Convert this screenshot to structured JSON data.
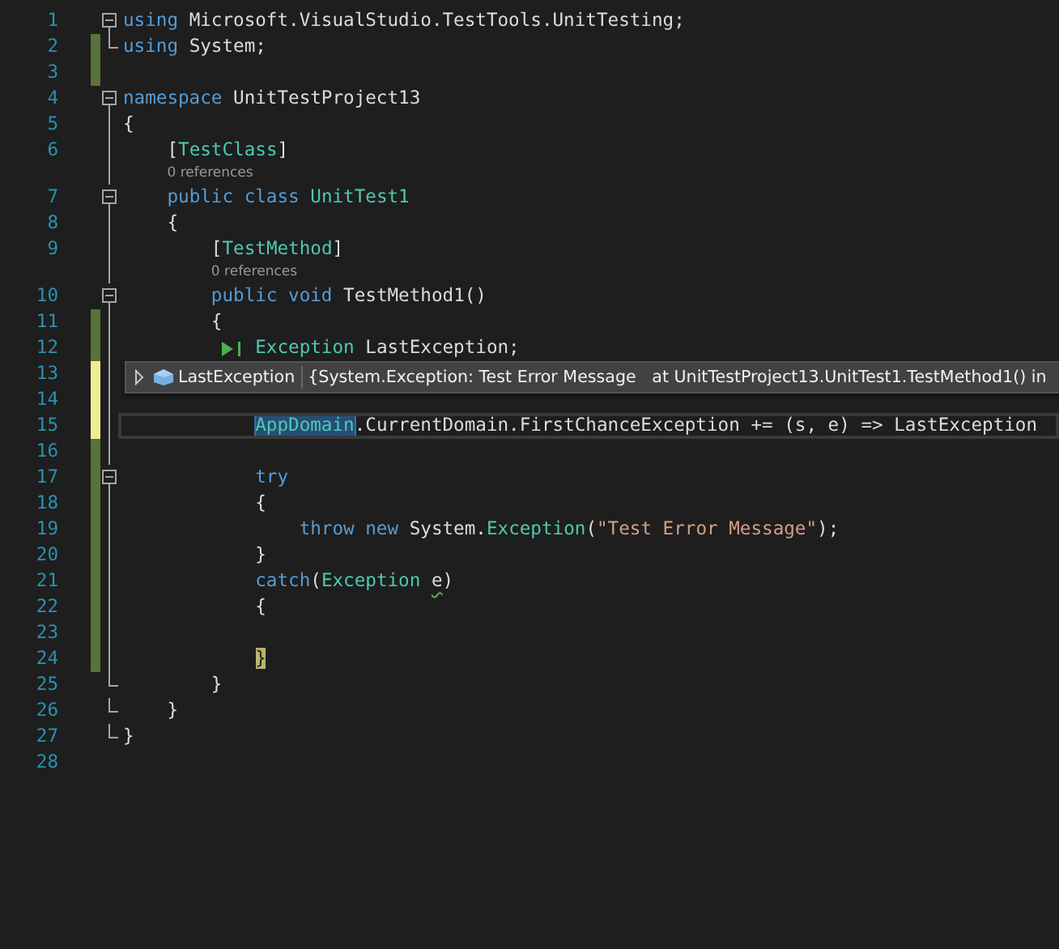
{
  "editor": {
    "lines": [
      {
        "kind": "code",
        "number": "1",
        "collapsible": true,
        "tokens": [
          {
            "text": "using",
            "kind": "keyword"
          },
          {
            "text": " Microsoft.VisualStudio.TestTools.UnitTesting;",
            "kind": "plain"
          }
        ]
      },
      {
        "kind": "code",
        "number": "2",
        "fold_end": true,
        "changed": true,
        "saved": true,
        "tokens": [
          {
            "text": "using",
            "kind": "keyword"
          },
          {
            "text": " System;",
            "kind": "plain"
          }
        ]
      },
      {
        "kind": "code",
        "number": "3",
        "changed": true,
        "saved": true
      },
      {
        "kind": "code",
        "number": "4",
        "collapsible": true,
        "tokens": [
          {
            "text": "namespace",
            "kind": "keyword"
          },
          {
            "text": " UnitTestProject13",
            "kind": "plain"
          }
        ]
      },
      {
        "kind": "code",
        "number": "5",
        "in_fold": true,
        "tokens": [
          {
            "text": "{",
            "kind": "plain"
          }
        ]
      },
      {
        "kind": "code",
        "number": "6",
        "in_fold": true,
        "tokens": [
          {
            "text": "    [",
            "kind": "plain"
          },
          {
            "text": "TestClass",
            "kind": "type"
          },
          {
            "text": "]",
            "kind": "plain"
          }
        ]
      },
      {
        "kind": "codelens",
        "in_fold": true,
        "text": "0 references"
      },
      {
        "kind": "code",
        "number": "7",
        "collapsible": true,
        "tokens": [
          {
            "text": "    public class",
            "kind": "keyword"
          },
          {
            "text": " UnitTest1",
            "kind": "type"
          }
        ]
      },
      {
        "kind": "code",
        "number": "8",
        "in_fold": true,
        "tokens": [
          {
            "text": "    {",
            "kind": "plain"
          }
        ]
      },
      {
        "kind": "code",
        "number": "9",
        "in_fold": true,
        "tokens": [
          {
            "text": "        [",
            "kind": "plain"
          },
          {
            "text": "TestMethod",
            "kind": "type"
          },
          {
            "text": "]",
            "kind": "plain"
          }
        ]
      },
      {
        "kind": "codelens",
        "in_fold": true,
        "text": "0 references"
      },
      {
        "kind": "code",
        "number": "10",
        "collapsible": true,
        "tokens": [
          {
            "text": "        public void",
            "kind": "keyword"
          },
          {
            "text": " TestMethod1()",
            "kind": "plain"
          }
        ]
      },
      {
        "kind": "code",
        "number": "11",
        "in_fold": true,
        "changed": true,
        "saved": true,
        "tokens": [
          {
            "text": "        {",
            "kind": "plain"
          }
        ]
      },
      {
        "kind": "code",
        "number": "12",
        "in_fold": true,
        "changed": true,
        "saved": true,
        "run_to_click": true,
        "tokens": [
          {
            "text": "            Exception",
            "kind": "type"
          },
          {
            "text": " LastException;",
            "kind": "plain"
          }
        ]
      },
      {
        "kind": "code",
        "number": "13",
        "in_fold": true,
        "changed": true,
        "saved": false,
        "datatip": {
          "name": "LastException",
          "value": "{System.Exception: Test Error Message   at UnitTestProject13.UnitTest1.TestMethod1() in"
        }
      },
      {
        "kind": "code",
        "number": "14",
        "in_fold": true,
        "changed": true,
        "saved": false
      },
      {
        "kind": "code",
        "number": "15",
        "in_fold": true,
        "changed": true,
        "saved": false,
        "current": true,
        "tokens": [
          {
            "text": "            AppDomain",
            "kind": "type",
            "selected": true
          },
          {
            "text": ".CurrentDomain.FirstChanceException += (s, e) => LastException",
            "kind": "plain"
          }
        ]
      },
      {
        "kind": "code",
        "number": "16",
        "in_fold": true,
        "changed": true,
        "saved": true
      },
      {
        "kind": "code",
        "number": "17",
        "collapsible": true,
        "changed": true,
        "saved": true,
        "tokens": [
          {
            "text": "            try",
            "kind": "keyword"
          }
        ]
      },
      {
        "kind": "code",
        "number": "18",
        "in_fold": true,
        "changed": true,
        "saved": true,
        "tokens": [
          {
            "text": "            {",
            "kind": "plain"
          }
        ]
      },
      {
        "kind": "code",
        "number": "19",
        "in_fold": true,
        "changed": true,
        "saved": true,
        "tokens": [
          {
            "text": "                throw new",
            "kind": "keyword"
          },
          {
            "text": " System.",
            "kind": "plain"
          },
          {
            "text": "Exception",
            "kind": "type"
          },
          {
            "text": "(",
            "kind": "plain"
          },
          {
            "text": "\"Test Error Message\"",
            "kind": "string"
          },
          {
            "text": ");",
            "kind": "plain"
          }
        ]
      },
      {
        "kind": "code",
        "number": "20",
        "in_fold": true,
        "changed": true,
        "saved": true,
        "tokens": [
          {
            "text": "            }",
            "kind": "plain"
          }
        ]
      },
      {
        "kind": "code",
        "number": "21",
        "in_fold": true,
        "changed": true,
        "saved": true,
        "tokens": [
          {
            "text": "            catch",
            "kind": "keyword"
          },
          {
            "text": "(",
            "kind": "plain"
          },
          {
            "text": "Exception ",
            "kind": "type"
          },
          {
            "text": "e",
            "kind": "plain",
            "squiggle": true
          },
          {
            "text": ")",
            "kind": "plain"
          }
        ]
      },
      {
        "kind": "code",
        "number": "22",
        "in_fold": true,
        "changed": true,
        "saved": true,
        "tokens": [
          {
            "text": "            {",
            "kind": "plain"
          }
        ]
      },
      {
        "kind": "code",
        "number": "23",
        "in_fold": true,
        "changed": true,
        "saved": true
      },
      {
        "kind": "code",
        "number": "24",
        "in_fold": true,
        "changed": true,
        "saved": true,
        "tokens": [
          {
            "text": "            }",
            "kind": "plain",
            "matched": true
          }
        ]
      },
      {
        "kind": "code",
        "number": "25",
        "fold_end": true,
        "tokens": [
          {
            "text": "        }",
            "kind": "plain"
          }
        ]
      },
      {
        "kind": "code",
        "number": "26",
        "fold_end": true,
        "tokens": [
          {
            "text": "    }",
            "kind": "plain"
          }
        ]
      },
      {
        "kind": "code",
        "number": "27",
        "fold_end": true,
        "tokens": [
          {
            "text": "}",
            "kind": "plain"
          }
        ]
      },
      {
        "kind": "code",
        "number": "28"
      }
    ]
  }
}
